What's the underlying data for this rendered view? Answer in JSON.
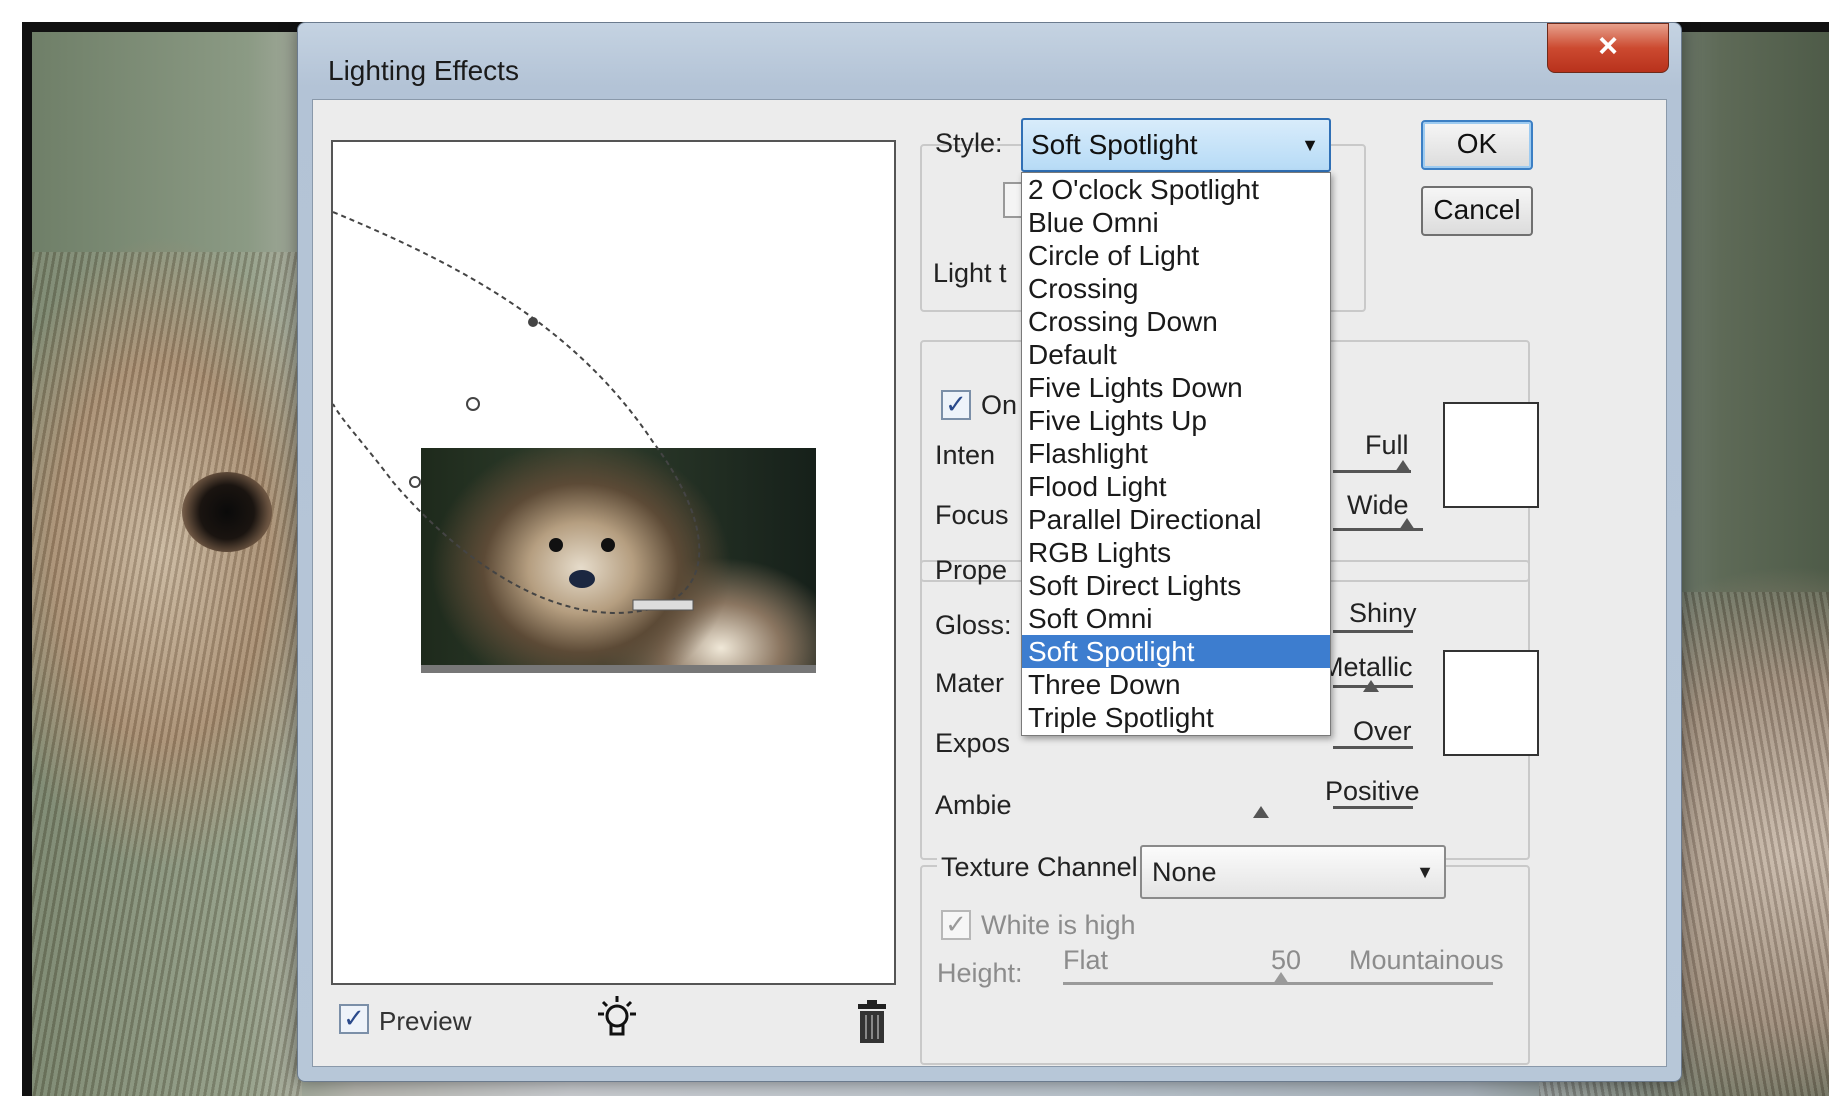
{
  "window": {
    "title": "Lighting Effects",
    "close_glyph": "×"
  },
  "buttons": {
    "ok": "OK",
    "cancel": "Cancel"
  },
  "style": {
    "label": "Style:",
    "selected": "Soft Spotlight",
    "options": [
      "2 O'clock Spotlight",
      "Blue Omni",
      "Circle of Light",
      "Crossing",
      "Crossing Down",
      "Default",
      "Five Lights Down",
      "Five Lights Up",
      "Flashlight",
      "Flood Light",
      "Parallel Directional",
      "RGB Lights",
      "Soft Direct Lights",
      "Soft Omni",
      "Soft Spotlight",
      "Three Down",
      "Triple Spotlight"
    ]
  },
  "light_type": {
    "group_label": "Light t",
    "on_label": "On",
    "on_checked": true,
    "intensity_label": "Inten",
    "intensity_right": "Full",
    "focus_label": "Focus",
    "focus_right": "Wide",
    "swatch_color": "#ffffff"
  },
  "properties": {
    "group_label": "Prope",
    "gloss_label": "Gloss:",
    "gloss_right": "Shiny",
    "material_label": "Mater",
    "material_right": "Metallic",
    "exposure_label": "Expos",
    "exposure_right": "Over",
    "ambience_label": "Ambie",
    "ambience_right": "Positive",
    "swatch_color": "#ffffff"
  },
  "texture": {
    "channel_label": "Texture Channel",
    "channel_value": "None",
    "white_is_high_label": "White is high",
    "white_is_high_checked": true,
    "height_label": "Height:",
    "height_min": "Flat",
    "height_value": "50",
    "height_max": "Mountainous"
  },
  "preview": {
    "label": "Preview",
    "checked": true,
    "check_glyph": "✓"
  },
  "icons": {
    "light_bulb": "light-bulb-icon",
    "trash": "trash-icon",
    "dropdown_arrow": "▼"
  },
  "colors": {
    "selection": "#3d7dcf",
    "dropdown_accent": "#b7dbf6",
    "close_button": "#cc4a30"
  }
}
